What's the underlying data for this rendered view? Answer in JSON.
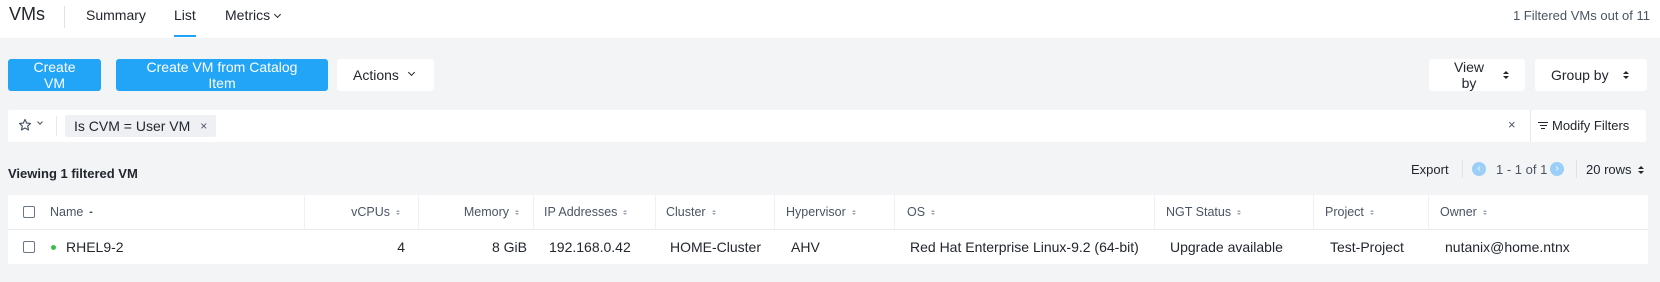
{
  "header": {
    "title": "VMs",
    "tabs": [
      {
        "label": "Summary"
      },
      {
        "label": "List"
      },
      {
        "label": "Metrics"
      }
    ],
    "filtered_count": "1 Filtered VMs out of 11"
  },
  "toolbar": {
    "create_vm": "Create VM",
    "create_from_catalog": "Create VM from Catalog Item",
    "actions": "Actions",
    "view_by": "View by",
    "group_by": "Group by"
  },
  "filter": {
    "chip": "Is CVM = User VM",
    "chip_remove": "×",
    "clear": "×",
    "modify": "Modify Filters"
  },
  "list_header": {
    "viewing": "Viewing 1 filtered VM",
    "export": "Export",
    "page_range": "1 - 1 of 1",
    "rows": "20 rows"
  },
  "table": {
    "columns": [
      "Name",
      "vCPUs",
      "Memory",
      "IP Addresses",
      "Cluster",
      "Hypervisor",
      "OS",
      "NGT Status",
      "Project",
      "Owner"
    ],
    "rows": [
      {
        "name": "RHEL9-2",
        "status": "running",
        "vcpus": "4",
        "memory": "8 GiB",
        "ip": "192.168.0.42",
        "cluster": "HOME-Cluster",
        "hypervisor": "AHV",
        "os": "Red Hat Enterprise Linux-9.2 (64-bit)",
        "ngt": "Upgrade available",
        "project": "Test-Project",
        "owner": "nutanix@home.ntnx"
      }
    ]
  },
  "colors": {
    "accent": "#22a5f7",
    "status_on": "#36c24a",
    "background": "#f2f4f6"
  },
  "icons": [
    "star-icon",
    "chevron-down-icon",
    "close-icon",
    "filter-icon",
    "chevron-left-icon",
    "chevron-right-icon",
    "sort-icon",
    "status-dot-icon"
  ]
}
